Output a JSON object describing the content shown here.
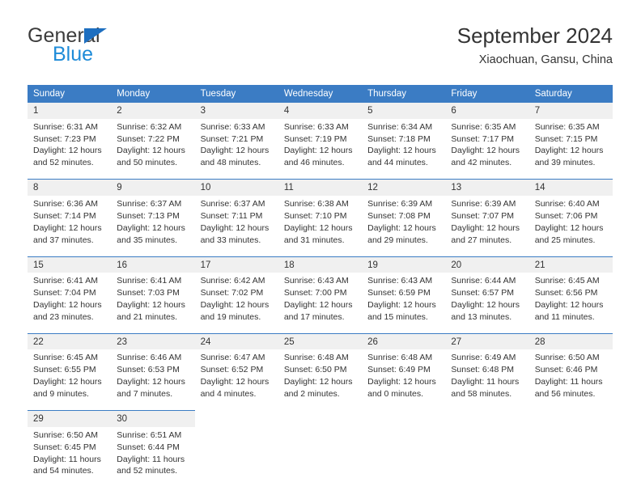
{
  "brand": {
    "name_dark": "General",
    "name_blue": "Blue",
    "accent_blue": "#1e6fc0",
    "light_blue": "#1e8bd8"
  },
  "header": {
    "title": "September 2024",
    "subtitle": "Xiaochuan, Gansu, China"
  },
  "calendar": {
    "header_bg": "#3b7cc4",
    "daynum_bg": "#f0f0f0",
    "weekdays": [
      "Sunday",
      "Monday",
      "Tuesday",
      "Wednesday",
      "Thursday",
      "Friday",
      "Saturday"
    ],
    "weeks": [
      [
        {
          "day": "1",
          "sunrise": "Sunrise: 6:31 AM",
          "sunset": "Sunset: 7:23 PM",
          "daylight1": "Daylight: 12 hours",
          "daylight2": "and 52 minutes."
        },
        {
          "day": "2",
          "sunrise": "Sunrise: 6:32 AM",
          "sunset": "Sunset: 7:22 PM",
          "daylight1": "Daylight: 12 hours",
          "daylight2": "and 50 minutes."
        },
        {
          "day": "3",
          "sunrise": "Sunrise: 6:33 AM",
          "sunset": "Sunset: 7:21 PM",
          "daylight1": "Daylight: 12 hours",
          "daylight2": "and 48 minutes."
        },
        {
          "day": "4",
          "sunrise": "Sunrise: 6:33 AM",
          "sunset": "Sunset: 7:19 PM",
          "daylight1": "Daylight: 12 hours",
          "daylight2": "and 46 minutes."
        },
        {
          "day": "5",
          "sunrise": "Sunrise: 6:34 AM",
          "sunset": "Sunset: 7:18 PM",
          "daylight1": "Daylight: 12 hours",
          "daylight2": "and 44 minutes."
        },
        {
          "day": "6",
          "sunrise": "Sunrise: 6:35 AM",
          "sunset": "Sunset: 7:17 PM",
          "daylight1": "Daylight: 12 hours",
          "daylight2": "and 42 minutes."
        },
        {
          "day": "7",
          "sunrise": "Sunrise: 6:35 AM",
          "sunset": "Sunset: 7:15 PM",
          "daylight1": "Daylight: 12 hours",
          "daylight2": "and 39 minutes."
        }
      ],
      [
        {
          "day": "8",
          "sunrise": "Sunrise: 6:36 AM",
          "sunset": "Sunset: 7:14 PM",
          "daylight1": "Daylight: 12 hours",
          "daylight2": "and 37 minutes."
        },
        {
          "day": "9",
          "sunrise": "Sunrise: 6:37 AM",
          "sunset": "Sunset: 7:13 PM",
          "daylight1": "Daylight: 12 hours",
          "daylight2": "and 35 minutes."
        },
        {
          "day": "10",
          "sunrise": "Sunrise: 6:37 AM",
          "sunset": "Sunset: 7:11 PM",
          "daylight1": "Daylight: 12 hours",
          "daylight2": "and 33 minutes."
        },
        {
          "day": "11",
          "sunrise": "Sunrise: 6:38 AM",
          "sunset": "Sunset: 7:10 PM",
          "daylight1": "Daylight: 12 hours",
          "daylight2": "and 31 minutes."
        },
        {
          "day": "12",
          "sunrise": "Sunrise: 6:39 AM",
          "sunset": "Sunset: 7:08 PM",
          "daylight1": "Daylight: 12 hours",
          "daylight2": "and 29 minutes."
        },
        {
          "day": "13",
          "sunrise": "Sunrise: 6:39 AM",
          "sunset": "Sunset: 7:07 PM",
          "daylight1": "Daylight: 12 hours",
          "daylight2": "and 27 minutes."
        },
        {
          "day": "14",
          "sunrise": "Sunrise: 6:40 AM",
          "sunset": "Sunset: 7:06 PM",
          "daylight1": "Daylight: 12 hours",
          "daylight2": "and 25 minutes."
        }
      ],
      [
        {
          "day": "15",
          "sunrise": "Sunrise: 6:41 AM",
          "sunset": "Sunset: 7:04 PM",
          "daylight1": "Daylight: 12 hours",
          "daylight2": "and 23 minutes."
        },
        {
          "day": "16",
          "sunrise": "Sunrise: 6:41 AM",
          "sunset": "Sunset: 7:03 PM",
          "daylight1": "Daylight: 12 hours",
          "daylight2": "and 21 minutes."
        },
        {
          "day": "17",
          "sunrise": "Sunrise: 6:42 AM",
          "sunset": "Sunset: 7:02 PM",
          "daylight1": "Daylight: 12 hours",
          "daylight2": "and 19 minutes."
        },
        {
          "day": "18",
          "sunrise": "Sunrise: 6:43 AM",
          "sunset": "Sunset: 7:00 PM",
          "daylight1": "Daylight: 12 hours",
          "daylight2": "and 17 minutes."
        },
        {
          "day": "19",
          "sunrise": "Sunrise: 6:43 AM",
          "sunset": "Sunset: 6:59 PM",
          "daylight1": "Daylight: 12 hours",
          "daylight2": "and 15 minutes."
        },
        {
          "day": "20",
          "sunrise": "Sunrise: 6:44 AM",
          "sunset": "Sunset: 6:57 PM",
          "daylight1": "Daylight: 12 hours",
          "daylight2": "and 13 minutes."
        },
        {
          "day": "21",
          "sunrise": "Sunrise: 6:45 AM",
          "sunset": "Sunset: 6:56 PM",
          "daylight1": "Daylight: 12 hours",
          "daylight2": "and 11 minutes."
        }
      ],
      [
        {
          "day": "22",
          "sunrise": "Sunrise: 6:45 AM",
          "sunset": "Sunset: 6:55 PM",
          "daylight1": "Daylight: 12 hours",
          "daylight2": "and 9 minutes."
        },
        {
          "day": "23",
          "sunrise": "Sunrise: 6:46 AM",
          "sunset": "Sunset: 6:53 PM",
          "daylight1": "Daylight: 12 hours",
          "daylight2": "and 7 minutes."
        },
        {
          "day": "24",
          "sunrise": "Sunrise: 6:47 AM",
          "sunset": "Sunset: 6:52 PM",
          "daylight1": "Daylight: 12 hours",
          "daylight2": "and 4 minutes."
        },
        {
          "day": "25",
          "sunrise": "Sunrise: 6:48 AM",
          "sunset": "Sunset: 6:50 PM",
          "daylight1": "Daylight: 12 hours",
          "daylight2": "and 2 minutes."
        },
        {
          "day": "26",
          "sunrise": "Sunrise: 6:48 AM",
          "sunset": "Sunset: 6:49 PM",
          "daylight1": "Daylight: 12 hours",
          "daylight2": "and 0 minutes."
        },
        {
          "day": "27",
          "sunrise": "Sunrise: 6:49 AM",
          "sunset": "Sunset: 6:48 PM",
          "daylight1": "Daylight: 11 hours",
          "daylight2": "and 58 minutes."
        },
        {
          "day": "28",
          "sunrise": "Sunrise: 6:50 AM",
          "sunset": "Sunset: 6:46 PM",
          "daylight1": "Daylight: 11 hours",
          "daylight2": "and 56 minutes."
        }
      ],
      [
        {
          "day": "29",
          "sunrise": "Sunrise: 6:50 AM",
          "sunset": "Sunset: 6:45 PM",
          "daylight1": "Daylight: 11 hours",
          "daylight2": "and 54 minutes."
        },
        {
          "day": "30",
          "sunrise": "Sunrise: 6:51 AM",
          "sunset": "Sunset: 6:44 PM",
          "daylight1": "Daylight: 11 hours",
          "daylight2": "and 52 minutes."
        },
        {
          "day": "",
          "sunrise": "",
          "sunset": "",
          "daylight1": "",
          "daylight2": ""
        },
        {
          "day": "",
          "sunrise": "",
          "sunset": "",
          "daylight1": "",
          "daylight2": ""
        },
        {
          "day": "",
          "sunrise": "",
          "sunset": "",
          "daylight1": "",
          "daylight2": ""
        },
        {
          "day": "",
          "sunrise": "",
          "sunset": "",
          "daylight1": "",
          "daylight2": ""
        },
        {
          "day": "",
          "sunrise": "",
          "sunset": "",
          "daylight1": "",
          "daylight2": ""
        }
      ]
    ]
  }
}
